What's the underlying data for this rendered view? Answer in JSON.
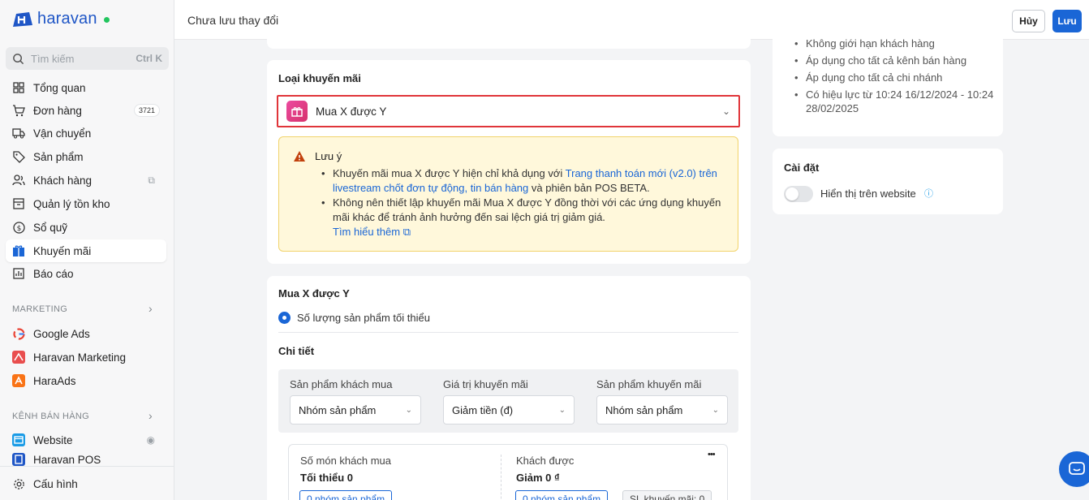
{
  "brand": {
    "name": "haravan",
    "accent": "#1a66d6",
    "status_color": "#22c55e"
  },
  "sidebar": {
    "search_placeholder": "Tìm kiếm",
    "search_shortcut": "Ctrl K",
    "items": [
      {
        "label": "Tổng quan",
        "icon": "dashboard-icon"
      },
      {
        "label": "Đơn hàng",
        "icon": "cart-icon",
        "badge": "3721"
      },
      {
        "label": "Vận chuyển",
        "icon": "truck-icon"
      },
      {
        "label": "Sản phẩm",
        "icon": "tag-icon"
      },
      {
        "label": "Khách hàng",
        "icon": "users-icon"
      },
      {
        "label": "Quản lý tồn kho",
        "icon": "inventory-icon"
      },
      {
        "label": "Sổ quỹ",
        "icon": "dollar-icon"
      },
      {
        "label": "Khuyến mãi",
        "icon": "gift-icon",
        "active": true
      },
      {
        "label": "Báo cáo",
        "icon": "chart-icon"
      }
    ],
    "marketing_label": "MARKETING",
    "marketing_items": [
      {
        "label": "Google Ads",
        "icon": "google-icon"
      },
      {
        "label": "Haravan Marketing",
        "icon": "haravan-marketing-icon"
      },
      {
        "label": "HaraAds",
        "icon": "haraads-icon"
      }
    ],
    "channels_label": "KÊNH BÁN HÀNG",
    "channel_items": [
      {
        "label": "Website",
        "icon": "website-icon"
      },
      {
        "label": "Haravan POS",
        "icon": "pos-icon"
      }
    ],
    "settings_label": "Cấu hình"
  },
  "topbar": {
    "title": "Chưa lưu thay đổi",
    "cancel_label": "Hủy",
    "save_label": "Lưu"
  },
  "promo_type": {
    "title": "Loại khuyến mãi",
    "selected": "Mua X được Y",
    "alert": {
      "title": "Lưu ý",
      "bullet1_prefix": "Khuyến mãi mua X được Y hiện chỉ khả dụng với ",
      "bullet1_link": "Trang thanh toán mới (v2.0) trên livestream chốt đơn tự động, tin bán hàng",
      "bullet1_suffix": " và phiên bản POS BETA.",
      "bullet2": "Không nên thiết lập khuyến mãi Mua X được Y đồng thời với các ứng dụng khuyến mãi khác để tránh ảnh hưởng đến sai lệch giá trị giảm giá.",
      "learn_more": "Tìm hiểu thêm"
    }
  },
  "buy_x_get_y": {
    "title": "Mua X được Y",
    "radio_label": "Số lượng sản phẩm tối thiểu",
    "detail_title": "Chi tiết",
    "columns": [
      {
        "label": "Sản phẩm khách mua",
        "value": "Nhóm sản phẩm"
      },
      {
        "label": "Giá trị khuyến mãi",
        "value": "Giảm tiền (đ)"
      },
      {
        "label": "Sản phẩm khuyến mãi",
        "value": "Nhóm sản phẩm"
      }
    ],
    "condition": {
      "buy_label": "Số món khách mua",
      "buy_value": "Tối thiểu 0",
      "buy_tag": "0 nhóm sản phẩm",
      "get_label": "Khách được",
      "get_value": "Giảm 0 ₫",
      "get_tag": "0 nhóm sản phẩm",
      "qty_tag": "SL khuyến mãi: 0",
      "more": "•••"
    }
  },
  "summary": {
    "items": [
      "Không giới hạn khách hàng",
      "Áp dụng cho tất cả kênh bán hàng",
      "Áp dụng cho tất cả chi nhánh",
      "Có hiệu lực từ 10:24 16/12/2024 - 10:24 28/02/2025"
    ]
  },
  "settings": {
    "title": "Cài đặt",
    "toggle_label": "Hiển thị trên website",
    "toggle_on": false
  }
}
